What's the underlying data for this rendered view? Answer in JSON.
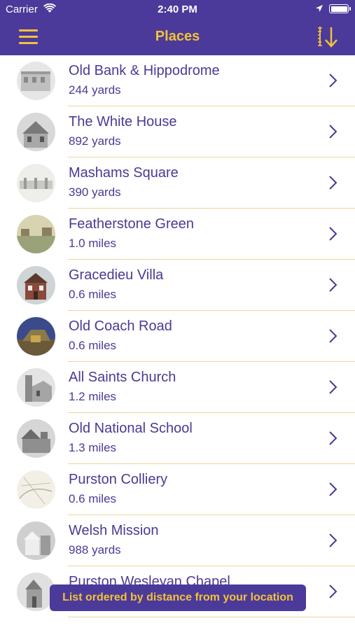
{
  "status_bar": {
    "carrier": "Carrier",
    "time": "2:40 PM",
    "wifi_icon": "wifi-icon",
    "location_icon": "location-arrow-icon",
    "battery_icon": "battery-icon"
  },
  "nav": {
    "title": "Places",
    "menu_icon": "hamburger-menu-icon",
    "sort_icon": "sort-descending-icon"
  },
  "colors": {
    "header": "#4b3a9a",
    "accent": "#f2c23a",
    "text": "#4a3a94",
    "separator": "#efd59a"
  },
  "places": [
    {
      "name": "Old Bank & Hippodrome",
      "distance": "244 yards"
    },
    {
      "name": "The White House",
      "distance": "892 yards"
    },
    {
      "name": "Mashams Square",
      "distance": "390 yards"
    },
    {
      "name": "Featherstone Green",
      "distance": "1.0 miles"
    },
    {
      "name": "Gracedieu Villa",
      "distance": "0.6 miles"
    },
    {
      "name": "Old Coach Road",
      "distance": "0.6 miles"
    },
    {
      "name": "All Saints Church",
      "distance": "1.2 miles"
    },
    {
      "name": "Old National School",
      "distance": "1.3 miles"
    },
    {
      "name": "Purston Colliery",
      "distance": "0.6 miles"
    },
    {
      "name": "Welsh Mission",
      "distance": "988 yards"
    },
    {
      "name": "Purston Wesleyan Chapel",
      "distance": ""
    }
  ],
  "toast": {
    "text": "List ordered by distance from your location"
  }
}
